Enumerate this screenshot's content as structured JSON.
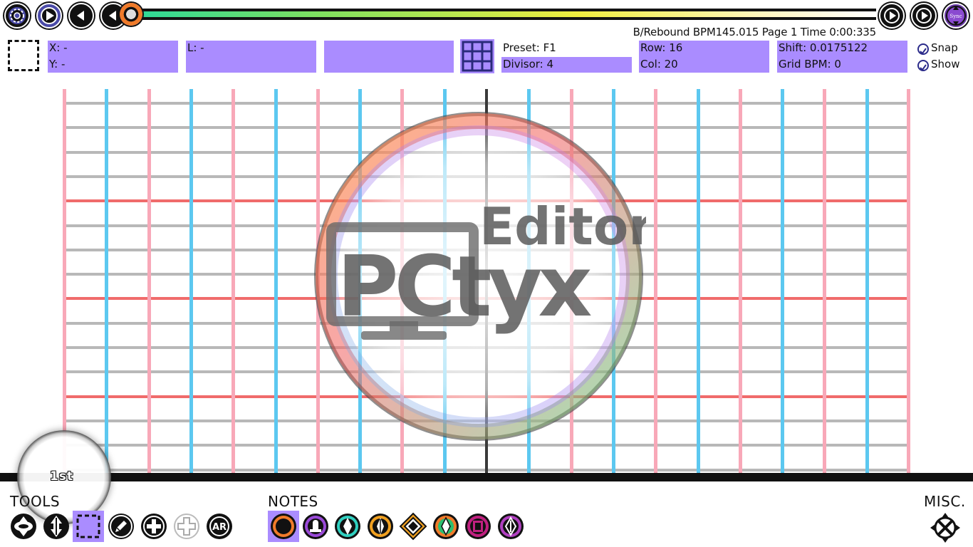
{
  "top_bar": {
    "buttons": [
      {
        "name": "settings-button",
        "icon": "gear-icon"
      },
      {
        "name": "play-button",
        "icon": "play-icon"
      },
      {
        "name": "step-back-button",
        "icon": "triangle-left-icon"
      },
      {
        "name": "prev-page-button",
        "icon": "triangle-left-icon"
      }
    ],
    "right_buttons": [
      {
        "name": "next-page-button",
        "icon": "triangle-right-icon"
      },
      {
        "name": "step-forward-button",
        "icon": "triangle-right-icon"
      }
    ],
    "sync_label": "Sync",
    "progress_fraction": 0.0,
    "progress_colors": [
      "#2bd99a",
      "#f0ee40",
      "#ffffff"
    ]
  },
  "status": {
    "text": "B/Rebound  BPM145.015 Page 1 Time 0:00:335"
  },
  "info": {
    "x_label": "X: -",
    "y_label": "Y: -",
    "l_label": "L: -",
    "blank_panel": "",
    "preset": "Preset: F1",
    "divisor": "Divisor: 4",
    "row": "Row: 16",
    "col": "Col: 20",
    "shift": "Shift: 0.0175122",
    "grid_bpm": "Grid BPM: 0",
    "snap": "Snap",
    "show": "Show",
    "panel_color": "#aa8cff"
  },
  "editor": {
    "rows": 16,
    "cols": 20,
    "major_every": 4,
    "colors": {
      "row": "#b8b8b8",
      "major_row": "#f06b6b",
      "col_a": "#f8a8b8",
      "col_b": "#5cc8f0",
      "center": "#3a3a3a"
    },
    "logo": {
      "word1": "Editor",
      "word2": "PCtyx"
    }
  },
  "magnifier": {
    "label": "1st"
  },
  "bottom": {
    "tools_label": "TOOLS",
    "notes_label": "NOTES",
    "misc_label": "MISC.",
    "tools": [
      "move-tool-icon",
      "flip-tool-icon",
      "select-tool-icon",
      "pencil-tool-icon",
      "add-tool-icon",
      "add-outline-tool-icon",
      "ar-tool-icon"
    ],
    "ar_text": "AR",
    "notes": [
      "tap-note-icon",
      "hold-note-icon",
      "drag-note-icon",
      "flick-note-icon",
      "diamond-note-icon",
      "arrow-note-icon",
      "chain-note-icon",
      "special-note-icon"
    ],
    "misc": "misc-arrows-icon"
  }
}
